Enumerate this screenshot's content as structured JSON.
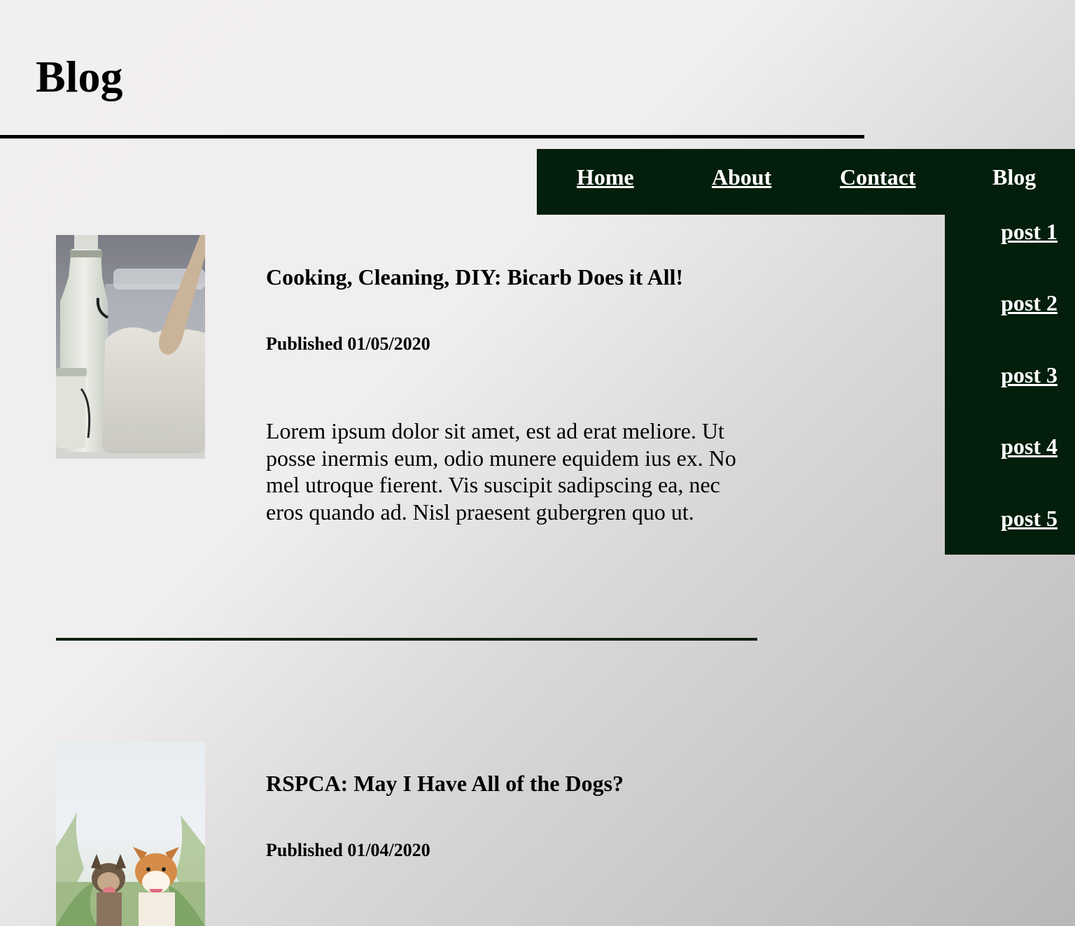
{
  "page": {
    "title": "Blog"
  },
  "nav": {
    "items": [
      {
        "label": "Home"
      },
      {
        "label": "About"
      },
      {
        "label": "Contact"
      },
      {
        "label": "Blog"
      }
    ],
    "dropdown": [
      {
        "label": "post 1"
      },
      {
        "label": "post 2"
      },
      {
        "label": "post 3"
      },
      {
        "label": "post 4"
      },
      {
        "label": "post 5"
      }
    ]
  },
  "posts": [
    {
      "title": "Cooking, Cleaning, DIY: Bicarb Does it All!",
      "date": "Published 01/05/2020",
      "excerpt": "Lorem ipsum dolor sit amet, est ad erat meliore. Ut posse inermis eum, odio munere equidem ius ex. No mel utroque fierent. Vis suscipit sadipscing ea, nec eros quando ad. Nisl praesent gubergren quo ut."
    },
    {
      "title": "RSPCA: May I Have All of the Dogs?",
      "date": "Published 01/04/2020"
    }
  ],
  "colors": {
    "nav_background": "#031e0a",
    "divider": "#0c1f10"
  }
}
